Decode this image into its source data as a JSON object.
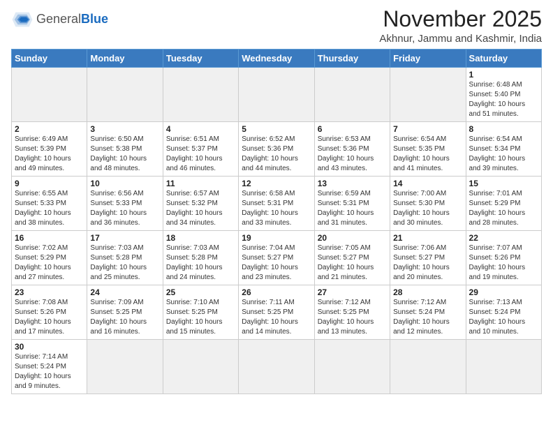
{
  "header": {
    "logo_general": "General",
    "logo_blue": "Blue",
    "month": "November 2025",
    "location": "Akhnur, Jammu and Kashmir, India"
  },
  "weekdays": [
    "Sunday",
    "Monday",
    "Tuesday",
    "Wednesday",
    "Thursday",
    "Friday",
    "Saturday"
  ],
  "weeks": [
    [
      {
        "day": "",
        "empty": true
      },
      {
        "day": "",
        "empty": true
      },
      {
        "day": "",
        "empty": true
      },
      {
        "day": "",
        "empty": true
      },
      {
        "day": "",
        "empty": true
      },
      {
        "day": "",
        "empty": true
      },
      {
        "day": "1",
        "sunrise": "Sunrise: 6:48 AM",
        "sunset": "Sunset: 5:40 PM",
        "daylight": "Daylight: 10 hours and 51 minutes."
      }
    ],
    [
      {
        "day": "2",
        "sunrise": "Sunrise: 6:49 AM",
        "sunset": "Sunset: 5:39 PM",
        "daylight": "Daylight: 10 hours and 49 minutes."
      },
      {
        "day": "3",
        "sunrise": "Sunrise: 6:50 AM",
        "sunset": "Sunset: 5:38 PM",
        "daylight": "Daylight: 10 hours and 48 minutes."
      },
      {
        "day": "4",
        "sunrise": "Sunrise: 6:51 AM",
        "sunset": "Sunset: 5:37 PM",
        "daylight": "Daylight: 10 hours and 46 minutes."
      },
      {
        "day": "5",
        "sunrise": "Sunrise: 6:52 AM",
        "sunset": "Sunset: 5:36 PM",
        "daylight": "Daylight: 10 hours and 44 minutes."
      },
      {
        "day": "6",
        "sunrise": "Sunrise: 6:53 AM",
        "sunset": "Sunset: 5:36 PM",
        "daylight": "Daylight: 10 hours and 43 minutes."
      },
      {
        "day": "7",
        "sunrise": "Sunrise: 6:54 AM",
        "sunset": "Sunset: 5:35 PM",
        "daylight": "Daylight: 10 hours and 41 minutes."
      },
      {
        "day": "8",
        "sunrise": "Sunrise: 6:54 AM",
        "sunset": "Sunset: 5:34 PM",
        "daylight": "Daylight: 10 hours and 39 minutes."
      }
    ],
    [
      {
        "day": "9",
        "sunrise": "Sunrise: 6:55 AM",
        "sunset": "Sunset: 5:33 PM",
        "daylight": "Daylight: 10 hours and 38 minutes."
      },
      {
        "day": "10",
        "sunrise": "Sunrise: 6:56 AM",
        "sunset": "Sunset: 5:33 PM",
        "daylight": "Daylight: 10 hours and 36 minutes."
      },
      {
        "day": "11",
        "sunrise": "Sunrise: 6:57 AM",
        "sunset": "Sunset: 5:32 PM",
        "daylight": "Daylight: 10 hours and 34 minutes."
      },
      {
        "day": "12",
        "sunrise": "Sunrise: 6:58 AM",
        "sunset": "Sunset: 5:31 PM",
        "daylight": "Daylight: 10 hours and 33 minutes."
      },
      {
        "day": "13",
        "sunrise": "Sunrise: 6:59 AM",
        "sunset": "Sunset: 5:31 PM",
        "daylight": "Daylight: 10 hours and 31 minutes."
      },
      {
        "day": "14",
        "sunrise": "Sunrise: 7:00 AM",
        "sunset": "Sunset: 5:30 PM",
        "daylight": "Daylight: 10 hours and 30 minutes."
      },
      {
        "day": "15",
        "sunrise": "Sunrise: 7:01 AM",
        "sunset": "Sunset: 5:29 PM",
        "daylight": "Daylight: 10 hours and 28 minutes."
      }
    ],
    [
      {
        "day": "16",
        "sunrise": "Sunrise: 7:02 AM",
        "sunset": "Sunset: 5:29 PM",
        "daylight": "Daylight: 10 hours and 27 minutes."
      },
      {
        "day": "17",
        "sunrise": "Sunrise: 7:03 AM",
        "sunset": "Sunset: 5:28 PM",
        "daylight": "Daylight: 10 hours and 25 minutes."
      },
      {
        "day": "18",
        "sunrise": "Sunrise: 7:03 AM",
        "sunset": "Sunset: 5:28 PM",
        "daylight": "Daylight: 10 hours and 24 minutes."
      },
      {
        "day": "19",
        "sunrise": "Sunrise: 7:04 AM",
        "sunset": "Sunset: 5:27 PM",
        "daylight": "Daylight: 10 hours and 23 minutes."
      },
      {
        "day": "20",
        "sunrise": "Sunrise: 7:05 AM",
        "sunset": "Sunset: 5:27 PM",
        "daylight": "Daylight: 10 hours and 21 minutes."
      },
      {
        "day": "21",
        "sunrise": "Sunrise: 7:06 AM",
        "sunset": "Sunset: 5:27 PM",
        "daylight": "Daylight: 10 hours and 20 minutes."
      },
      {
        "day": "22",
        "sunrise": "Sunrise: 7:07 AM",
        "sunset": "Sunset: 5:26 PM",
        "daylight": "Daylight: 10 hours and 19 minutes."
      }
    ],
    [
      {
        "day": "23",
        "sunrise": "Sunrise: 7:08 AM",
        "sunset": "Sunset: 5:26 PM",
        "daylight": "Daylight: 10 hours and 17 minutes."
      },
      {
        "day": "24",
        "sunrise": "Sunrise: 7:09 AM",
        "sunset": "Sunset: 5:25 PM",
        "daylight": "Daylight: 10 hours and 16 minutes."
      },
      {
        "day": "25",
        "sunrise": "Sunrise: 7:10 AM",
        "sunset": "Sunset: 5:25 PM",
        "daylight": "Daylight: 10 hours and 15 minutes."
      },
      {
        "day": "26",
        "sunrise": "Sunrise: 7:11 AM",
        "sunset": "Sunset: 5:25 PM",
        "daylight": "Daylight: 10 hours and 14 minutes."
      },
      {
        "day": "27",
        "sunrise": "Sunrise: 7:12 AM",
        "sunset": "Sunset: 5:25 PM",
        "daylight": "Daylight: 10 hours and 13 minutes."
      },
      {
        "day": "28",
        "sunrise": "Sunrise: 7:12 AM",
        "sunset": "Sunset: 5:24 PM",
        "daylight": "Daylight: 10 hours and 12 minutes."
      },
      {
        "day": "29",
        "sunrise": "Sunrise: 7:13 AM",
        "sunset": "Sunset: 5:24 PM",
        "daylight": "Daylight: 10 hours and 10 minutes."
      }
    ],
    [
      {
        "day": "30",
        "sunrise": "Sunrise: 7:14 AM",
        "sunset": "Sunset: 5:24 PM",
        "daylight": "Daylight: 10 hours and 9 minutes."
      },
      {
        "day": "",
        "empty": true
      },
      {
        "day": "",
        "empty": true
      },
      {
        "day": "",
        "empty": true
      },
      {
        "day": "",
        "empty": true
      },
      {
        "day": "",
        "empty": true
      },
      {
        "day": "",
        "empty": true
      }
    ]
  ]
}
